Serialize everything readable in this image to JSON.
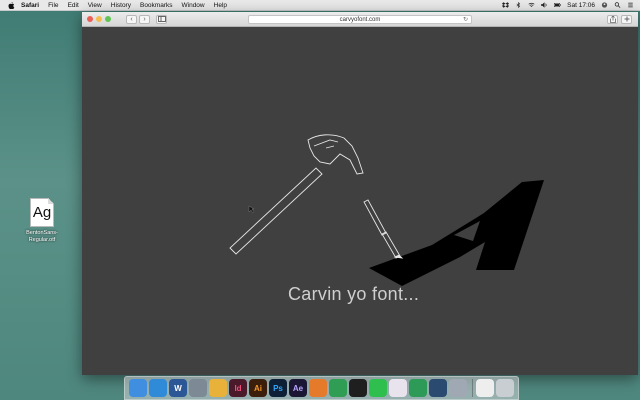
{
  "menubar": {
    "app_name": "Safari",
    "items": [
      "File",
      "Edit",
      "View",
      "History",
      "Bookmarks",
      "Window",
      "Help"
    ],
    "clock": "Sat 17:06"
  },
  "desktop": {
    "file": {
      "thumb": "Ag",
      "name_line1": "BentonSans-",
      "name_line2": "Regular.otf"
    }
  },
  "browser": {
    "url": "carvyofont.com",
    "back_glyph": "‹",
    "forward_glyph": "›"
  },
  "page": {
    "loading_text": "Carvin yo font...",
    "background_color": "#404040",
    "glyph_color": "#000000",
    "outline_color": "#e6e6e6"
  },
  "dock": {
    "apps": [
      {
        "name": "finder",
        "color": "#3f8ee0",
        "label": ""
      },
      {
        "name": "safari",
        "color": "#2f8bd8",
        "label": ""
      },
      {
        "name": "word",
        "color": "#2b5797",
        "label": "W"
      },
      {
        "name": "preview",
        "color": "#7d8a95",
        "label": ""
      },
      {
        "name": "chrome",
        "color": "#e8b23a",
        "label": ""
      },
      {
        "name": "indesign",
        "color": "#4a1a2a",
        "label": "Id"
      },
      {
        "name": "illustrator",
        "color": "#3b1e0c",
        "label": "Ai"
      },
      {
        "name": "photoshop",
        "color": "#0d2035",
        "label": "Ps"
      },
      {
        "name": "after-effects",
        "color": "#1c1635",
        "label": "Ae"
      },
      {
        "name": "sublime",
        "color": "#e57b2a",
        "label": ""
      },
      {
        "name": "hangouts",
        "color": "#2f9d53",
        "label": ""
      },
      {
        "name": "spotify",
        "color": "#1f1f1f",
        "label": ""
      },
      {
        "name": "whatsapp",
        "color": "#2fbf4f",
        "label": ""
      },
      {
        "name": "slack",
        "color": "#e9e3ee",
        "label": ""
      },
      {
        "name": "hangouts-2",
        "color": "#2e9a58",
        "label": ""
      },
      {
        "name": "quicktime",
        "color": "#2b4a70",
        "label": ""
      },
      {
        "name": "app-store",
        "color": "#a0a8b3",
        "label": ""
      },
      {
        "name": "documents",
        "color": "#eeeeee",
        "label": ""
      },
      {
        "name": "trash",
        "color": "#c9ced3",
        "label": ""
      }
    ]
  }
}
